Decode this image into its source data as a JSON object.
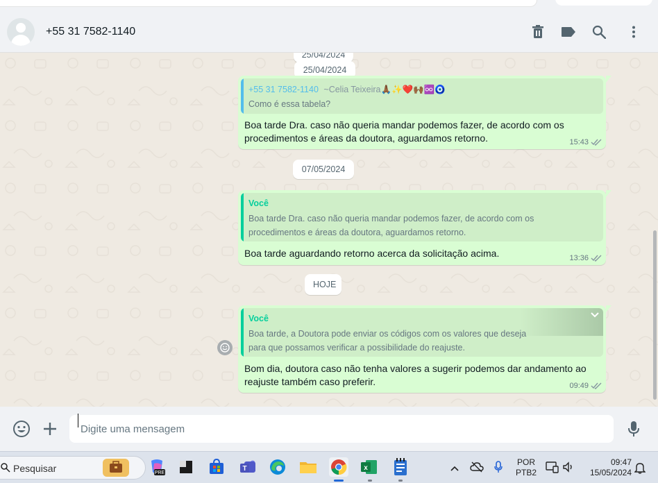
{
  "header": {
    "contact_name": "+55 31 7582-1140",
    "icons": [
      "trash-icon",
      "label-icon",
      "search-icon",
      "more-vert-icon"
    ]
  },
  "chat": {
    "partial_date": "25/04/2024",
    "messages": [
      {
        "date": "25/04/2024",
        "quote": {
          "author": "+55 31 7582-1140",
          "author_extra": "~Celia Teixeira🙏🏾✨❤️🙌🏾♾️🧿",
          "lines": [
            "Como é essa tabela?"
          ],
          "color": "#53bdeb"
        },
        "lines": [
          "Boa tarde Dra. caso não queria mandar podemos fazer, de acordo com os",
          "procedimentos e áreas da doutora, aguardamos retorno."
        ],
        "time": "15:43"
      },
      {
        "date": "07/05/2024",
        "quote": {
          "author": "Você",
          "lines": [
            "Boa tarde Dra. caso não queria mandar podemos fazer, de acordo com os",
            "procedimentos e áreas da doutora, aguardamos retorno."
          ],
          "color": "#06cf9c"
        },
        "lines": [
          "Boa tarde aguardando retorno acerca da solicitação acima."
        ],
        "time": "13:36"
      },
      {
        "date": "HOJE",
        "quote": {
          "author": "Você",
          "lines": [
            "Boa tarde, a Doutora pode enviar os códigos com os valores que deseja",
            "para que possamos verificar a possibilidade do reajuste."
          ],
          "color": "#06cf9c"
        },
        "lines": [
          "Bom dia, doutora caso não tenha valores a sugerir podemos dar andamento ao",
          "reajuste também caso preferir."
        ],
        "time": "09:49"
      }
    ]
  },
  "composer": {
    "placeholder": "Digite uma mensagem",
    "icons": [
      "emoji-icon",
      "plus-icon",
      "mic-icon"
    ]
  },
  "taskbar": {
    "search_label": "Pesquisar",
    "apps": [
      "briefcase-icon",
      "copilot-icon",
      "terminal-icon",
      "store-icon",
      "teams-icon",
      "edge-icon",
      "file-explorer-icon",
      "chrome-icon",
      "excel-icon",
      "notepad-icon"
    ],
    "lang_top": "POR",
    "lang_bottom": "PTB2",
    "time": "09:47",
    "date": "15/05/2024"
  },
  "colors": {
    "bubble": "#d9fdd3",
    "quote_you": "#06cf9c",
    "quote_other": "#53bdeb",
    "chat_bg": "#efeae2"
  }
}
